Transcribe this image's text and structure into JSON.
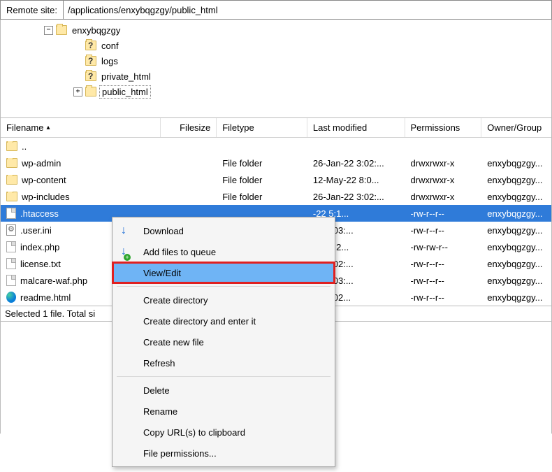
{
  "path_bar": {
    "label": "Remote site:",
    "value": "/applications/enxybqgzgy/public_html"
  },
  "tree": {
    "root": "enxybqgzgy",
    "children": [
      {
        "label": "conf",
        "q": true
      },
      {
        "label": "logs",
        "q": true
      },
      {
        "label": "private_html",
        "q": true
      },
      {
        "label": "public_html",
        "q": false,
        "expander": "+",
        "selected": true
      }
    ]
  },
  "columns": {
    "name": "Filename",
    "size": "Filesize",
    "type": "Filetype",
    "mod": "Last modified",
    "perm": "Permissions",
    "own": "Owner/Group"
  },
  "rows": [
    {
      "icon": "folder",
      "name": "..",
      "size": "",
      "type": "",
      "mod": "",
      "perm": "",
      "own": ""
    },
    {
      "icon": "folder",
      "name": "wp-admin",
      "size": "",
      "type": "File folder",
      "mod": "26-Jan-22 3:02:...",
      "perm": "drwxrwxr-x",
      "own": "enxybqgzgy..."
    },
    {
      "icon": "folder",
      "name": "wp-content",
      "size": "",
      "type": "File folder",
      "mod": "12-May-22 8:0...",
      "perm": "drwxrwxr-x",
      "own": "enxybqgzgy..."
    },
    {
      "icon": "folder",
      "name": "wp-includes",
      "size": "",
      "type": "File folder",
      "mod": "26-Jan-22 3:02:...",
      "perm": "drwxrwxr-x",
      "own": "enxybqgzgy..."
    },
    {
      "icon": "doc",
      "name": ".htaccess",
      "size": "",
      "type": "",
      "mod": "-22 5:1...",
      "perm": "-rw-r--r--",
      "own": "enxybqgzgy...",
      "selected": true
    },
    {
      "icon": "cfg",
      "name": ".user.ini",
      "size": "",
      "type": "",
      "mod": "22 6:03:...",
      "perm": "-rw-r--r--",
      "own": "enxybqgzgy..."
    },
    {
      "icon": "doc",
      "name": "index.php",
      "size": "",
      "type": "",
      "mod": "-21 2:2...",
      "perm": "-rw-rw-r--",
      "own": "enxybqgzgy..."
    },
    {
      "icon": "doc",
      "name": "license.txt",
      "size": "",
      "type": "",
      "mod": "22 3:02:...",
      "perm": "-rw-r--r--",
      "own": "enxybqgzgy..."
    },
    {
      "icon": "doc",
      "name": "malcare-waf.php",
      "size": "",
      "type": "",
      "mod": "22 6:03:...",
      "perm": "-rw-r--r--",
      "own": "enxybqgzgy..."
    },
    {
      "icon": "edge",
      "name": "readme.html",
      "size": "",
      "type": "",
      "mod": "22 2:02...",
      "perm": "-rw-r--r--",
      "own": "enxybqgzgy..."
    }
  ],
  "status": "Selected 1 file. Total si",
  "ctx": {
    "download": "Download",
    "queue": "Add files to queue",
    "viewedit": "View/Edit",
    "createdir": "Create directory",
    "createdir_enter": "Create directory and enter it",
    "newfile": "Create new file",
    "refresh": "Refresh",
    "delete": "Delete",
    "rename": "Rename",
    "copyurl": "Copy URL(s) to clipboard",
    "fileperms": "File permissions..."
  }
}
